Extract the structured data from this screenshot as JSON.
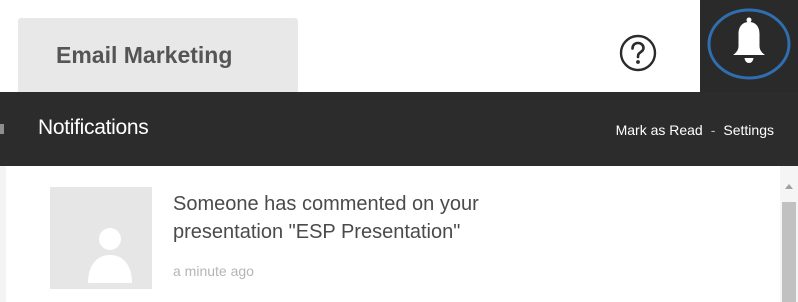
{
  "header": {
    "tab_label": "Email Marketing",
    "help_icon": "question-circle-icon",
    "bell_icon": "bell-icon"
  },
  "notifications": {
    "title": "Notifications",
    "actions": {
      "mark_read": "Mark as Read",
      "separator": "-",
      "settings": "Settings"
    },
    "items": [
      {
        "message": "Someone has commented on your presentation \"ESP Presentation\"",
        "time": "a minute ago",
        "avatar_icon": "user-placeholder-icon"
      }
    ]
  },
  "colors": {
    "header_bg": "#2c2c2c",
    "tab_bg": "#e8e8e8",
    "bell_highlight": "#2f6fb0",
    "text_dark": "#4a4a4a",
    "text_muted": "#b5b5b5"
  }
}
